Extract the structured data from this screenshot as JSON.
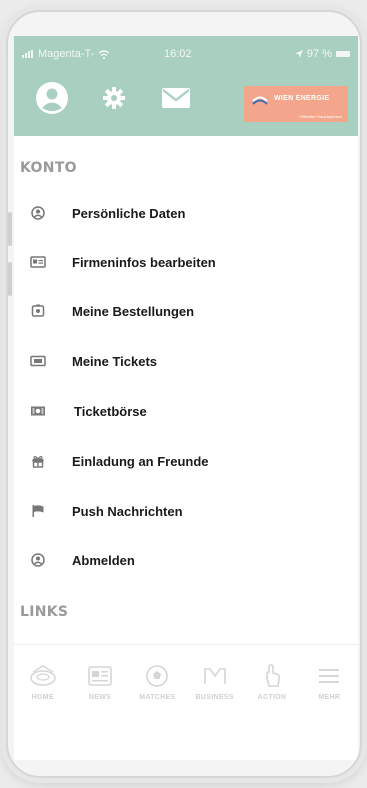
{
  "status_bar": {
    "carrier": "Magenta-T-",
    "time": "16:02",
    "battery": "97 %"
  },
  "header": {
    "logo_text": "WIEN ENERGIE",
    "logo_subtitle": "Offizieller Hauptsponsor",
    "accent_color": "#a9cfc0"
  },
  "sections": {
    "konto_title": "KONTO",
    "links_title": "LINKS"
  },
  "menu": {
    "items": [
      {
        "label": "Persönliche Daten",
        "icon": "user-circle-icon"
      },
      {
        "label": "Firmeninfos bearbeiten",
        "icon": "id-card-icon"
      },
      {
        "label": "Meine Bestellungen",
        "icon": "receipt-icon"
      },
      {
        "label": "Meine Tickets",
        "icon": "ticket-icon"
      },
      {
        "label": "Ticketbörse",
        "icon": "money-icon"
      },
      {
        "label": "Einladung an Freunde",
        "icon": "gift-icon"
      },
      {
        "label": "Push Nachrichten",
        "icon": "flag-icon"
      },
      {
        "label": "Abmelden",
        "icon": "logout-icon"
      }
    ]
  },
  "tabbar": {
    "tabs": [
      {
        "label": "HOME",
        "icon": "stadium-icon"
      },
      {
        "label": "NEWS",
        "icon": "newspaper-icon"
      },
      {
        "label": "MATCHES",
        "icon": "football-icon"
      },
      {
        "label": "BUSINESS",
        "icon": "handshake-icon"
      },
      {
        "label": "ACTION",
        "icon": "hand-pointer-icon"
      },
      {
        "label": "MEHR",
        "icon": "menu-icon"
      }
    ]
  }
}
